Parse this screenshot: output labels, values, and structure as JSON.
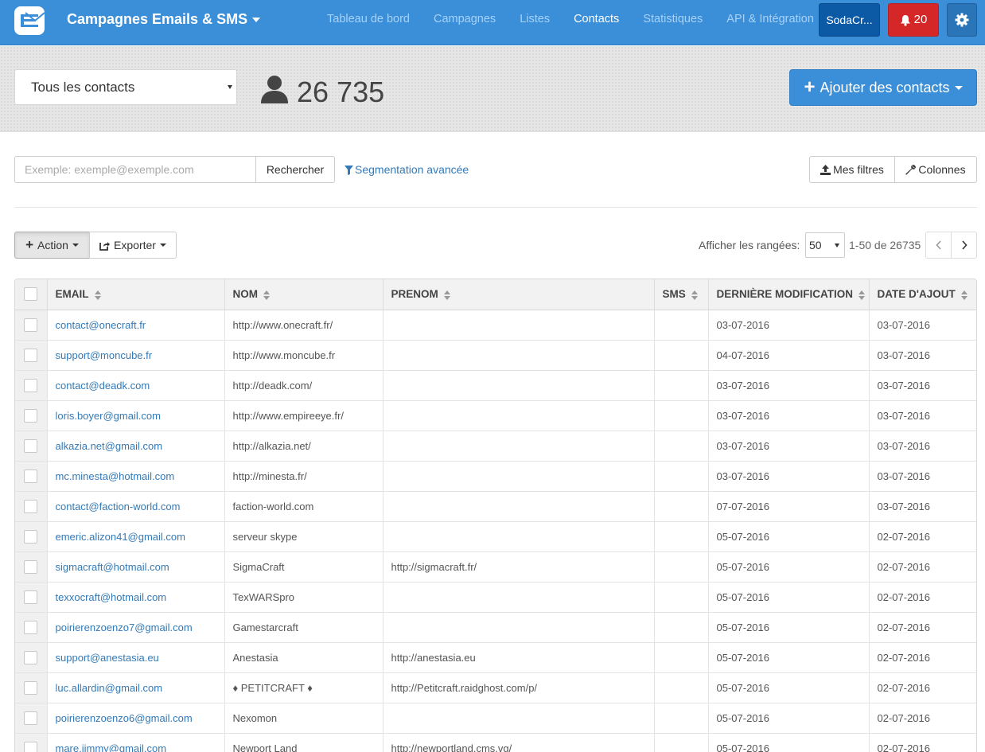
{
  "navbar": {
    "app_title": "Campagnes Emails & SMS",
    "links": [
      {
        "label": "Tableau de bord",
        "active": false
      },
      {
        "label": "Campagnes",
        "active": false
      },
      {
        "label": "Listes",
        "active": false
      },
      {
        "label": "Contacts",
        "active": true
      },
      {
        "label": "Statistiques",
        "active": false
      },
      {
        "label": "API & Intégration",
        "active": false
      }
    ],
    "account_label": "SodaCr...",
    "notifications_count": "20",
    "colors": {
      "bar": "#3b8ed8",
      "account": "#0c5aa6",
      "notif": "#d52727"
    }
  },
  "header": {
    "list_selected": "Tous les contacts",
    "contact_count": "26 735",
    "add_button_label": "Ajouter des contacts"
  },
  "search": {
    "placeholder": "Exemple: exemple@exemple.com",
    "button_label": "Rechercher",
    "segmentation_label": "Segmentation avancée",
    "filters_label": "Mes filtres",
    "columns_label": "Colonnes"
  },
  "toolbar": {
    "action_label": "Action",
    "export_label": "Exporter",
    "rows_label": "Afficher les rangées:",
    "rows_value": "50",
    "range_label": "1-50 de 26735"
  },
  "table": {
    "columns": [
      "EMAIL",
      "NOM",
      "PRENOM",
      "SMS",
      "DERNIÈRE MODIFICATION",
      "DATE D'AJOUT"
    ],
    "rows": [
      [
        "contact@onecraft.fr",
        "http://www.onecraft.fr/",
        "",
        "",
        "03-07-2016",
        "03-07-2016"
      ],
      [
        "support@moncube.fr",
        "http://www.moncube.fr",
        "",
        "",
        "04-07-2016",
        "03-07-2016"
      ],
      [
        "contact@deadk.com",
        "http://deadk.com/",
        "",
        "",
        "03-07-2016",
        "03-07-2016"
      ],
      [
        "loris.boyer@gmail.com",
        "http://www.empireeye.fr/",
        "",
        "",
        "03-07-2016",
        "03-07-2016"
      ],
      [
        "alkazia.net@gmail.com",
        "http://alkazia.net/",
        "",
        "",
        "03-07-2016",
        "03-07-2016"
      ],
      [
        "mc.minesta@hotmail.com",
        "http://minesta.fr/",
        "",
        "",
        "03-07-2016",
        "03-07-2016"
      ],
      [
        "contact@faction-world.com",
        "faction-world.com",
        "",
        "",
        "07-07-2016",
        "03-07-2016"
      ],
      [
        "emeric.alizon41@gmail.com",
        "serveur skype",
        "",
        "",
        "05-07-2016",
        "02-07-2016"
      ],
      [
        "sigmacraft@hotmail.com",
        "SigmaCraft",
        "http://sigmacraft.fr/",
        "",
        "05-07-2016",
        "02-07-2016"
      ],
      [
        "texxocraft@hotmail.com",
        "TexWARSpro",
        "",
        "",
        "05-07-2016",
        "02-07-2016"
      ],
      [
        "poirierenzoenzo7@gmail.com",
        "Gamestarcraft",
        "",
        "",
        "05-07-2016",
        "02-07-2016"
      ],
      [
        "support@anestasia.eu",
        "Anestasia",
        "http://anestasia.eu",
        "",
        "05-07-2016",
        "02-07-2016"
      ],
      [
        "luc.allardin@gmail.com",
        "♦ PETITCRAFT ♦",
        "http://Petitcraft.raidghost.com/p/",
        "",
        "05-07-2016",
        "02-07-2016"
      ],
      [
        "poirierenzoenzo6@gmail.com",
        "Nexomon",
        "",
        "",
        "05-07-2016",
        "02-07-2016"
      ],
      [
        "mare.jimmy@gmail.com",
        "Newport Land",
        "http://newportland.cms.vg/",
        "",
        "05-07-2016",
        "02-07-2016"
      ]
    ]
  }
}
